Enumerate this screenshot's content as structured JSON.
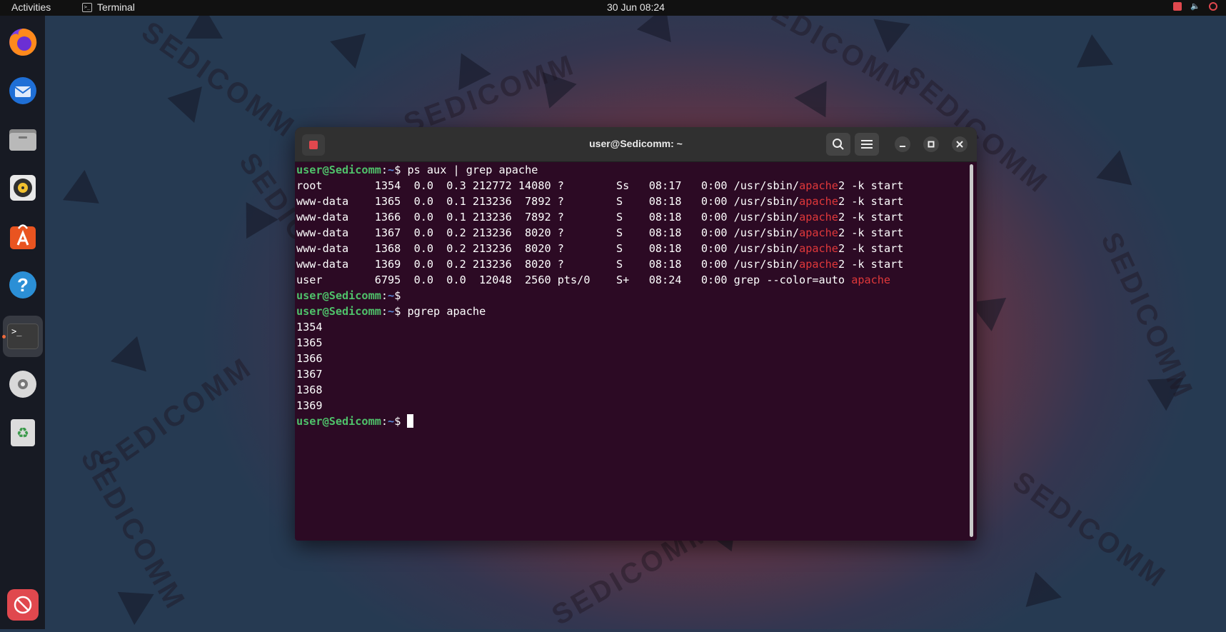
{
  "topbar": {
    "activities": "Activities",
    "app_name": "Terminal",
    "app_icon_glyph": ">_",
    "clock": "30 Jun  08:24",
    "volume_glyph": "🔈"
  },
  "dock": {
    "items": [
      {
        "name": "firefox"
      },
      {
        "name": "thunderbird"
      },
      {
        "name": "files"
      },
      {
        "name": "rhythmbox"
      },
      {
        "name": "software"
      },
      {
        "name": "help",
        "glyph": "?"
      },
      {
        "name": "terminal",
        "glyph": ">_"
      },
      {
        "name": "disc"
      },
      {
        "name": "trash",
        "glyph": "♻"
      }
    ],
    "apps_glyph": "⃠"
  },
  "wallpaper": {
    "word": "SEDICOMM"
  },
  "terminal": {
    "title": "user@Sedicomm: ~",
    "prompt": {
      "user": "user@Sedicomm",
      "sep": ":",
      "path": "~",
      "sym": "$ "
    },
    "lines": [
      {
        "type": "prompt",
        "cmd": "ps aux | grep apache"
      },
      {
        "type": "out",
        "pre": "root        1354  0.0  0.3 212772 14080 ?        Ss   08:17   0:00 /usr/sbin/",
        "hl": "apache",
        "post": "2 -k start"
      },
      {
        "type": "out",
        "pre": "www-data    1365  0.0  0.1 213236  7892 ?        S    08:18   0:00 /usr/sbin/",
        "hl": "apache",
        "post": "2 -k start"
      },
      {
        "type": "out",
        "pre": "www-data    1366  0.0  0.1 213236  7892 ?        S    08:18   0:00 /usr/sbin/",
        "hl": "apache",
        "post": "2 -k start"
      },
      {
        "type": "out",
        "pre": "www-data    1367  0.0  0.2 213236  8020 ?        S    08:18   0:00 /usr/sbin/",
        "hl": "apache",
        "post": "2 -k start"
      },
      {
        "type": "out",
        "pre": "www-data    1368  0.0  0.2 213236  8020 ?        S    08:18   0:00 /usr/sbin/",
        "hl": "apache",
        "post": "2 -k start"
      },
      {
        "type": "out",
        "pre": "www-data    1369  0.0  0.2 213236  8020 ?        S    08:18   0:00 /usr/sbin/",
        "hl": "apache",
        "post": "2 -k start"
      },
      {
        "type": "out",
        "pre": "user        6795  0.0  0.0  12048  2560 pts/0    S+   08:24   0:00 grep --color=auto ",
        "hl": "apache",
        "post": ""
      },
      {
        "type": "prompt",
        "cmd": ""
      },
      {
        "type": "prompt",
        "cmd": "pgrep apache"
      },
      {
        "type": "out",
        "pre": "1354",
        "hl": "",
        "post": ""
      },
      {
        "type": "out",
        "pre": "1365",
        "hl": "",
        "post": ""
      },
      {
        "type": "out",
        "pre": "1366",
        "hl": "",
        "post": ""
      },
      {
        "type": "out",
        "pre": "1367",
        "hl": "",
        "post": ""
      },
      {
        "type": "out",
        "pre": "1368",
        "hl": "",
        "post": ""
      },
      {
        "type": "out",
        "pre": "1369",
        "hl": "",
        "post": ""
      },
      {
        "type": "prompt",
        "cmd": "",
        "cursor": true
      }
    ]
  },
  "colors": {
    "prompt_user": "#4fc16a",
    "prompt_path": "#5a86d6",
    "match_highlight": "#e0383a",
    "terminal_bg": "#2c0a24",
    "accent": "#e95420"
  }
}
